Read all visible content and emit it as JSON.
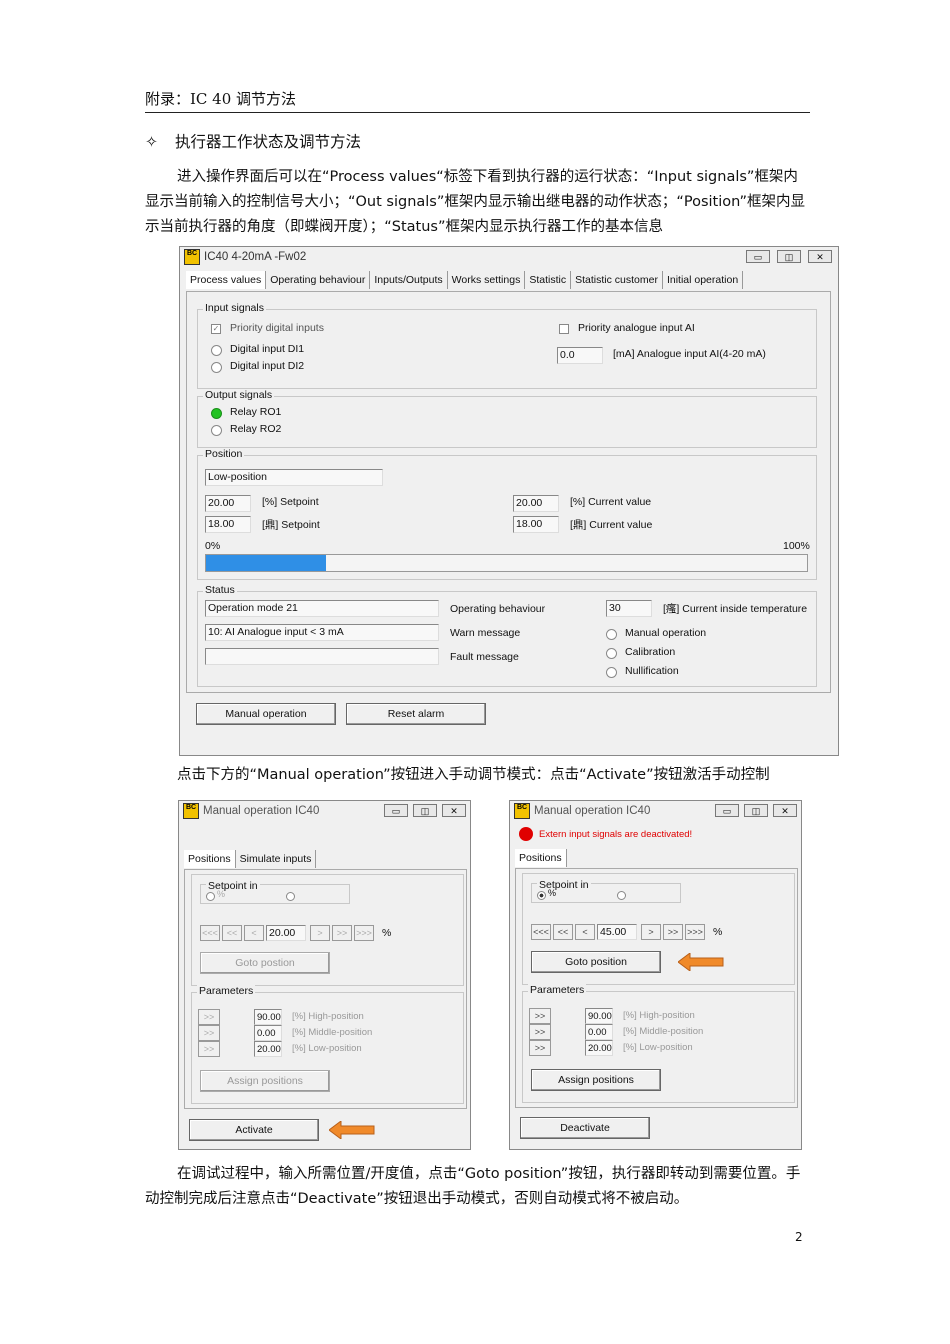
{
  "header": "附录：IC 40 调节方法",
  "section": {
    "bullet": "✧",
    "title": "执行器工作状态及调节方法"
  },
  "para1": "进入操作界面后可以在“Process values“标签下看到执行器的运行状态：“Input signals”框架内显示当前输入的控制信号大小；“Out signals”框架内显示输出继电器的动作状态；“Position”框架内显示当前执行器的角度（即蝶阀开度）；“Status”框架内显示执行器工作的基本信息",
  "para2": "点击下方的“Manual operation”按钮进入手动调节模式：点击“Activate”按钮激活手动控制",
  "para3": "在调试过程中，输入所需位置/开度值，点击“Goto position”按钮，执行器即转动到需要位置。手动控制完成后注意点击“Deactivate”按钮退出手动模式，否则自动模式将不被启动。",
  "page_number": "2",
  "main_window": {
    "logo": "BC",
    "title": "IC40 4-20mA -Fw02",
    "tabs": [
      "Process values",
      "Operating behaviour",
      "Inputs/Outputs",
      "Works settings",
      "Statistic",
      "Statistic customer",
      "Initial operation"
    ],
    "input_signals": {
      "label": "Input signals",
      "priority_digital": "Priority digital inputs",
      "di1": "Digital input DI1",
      "di2": "Digital input DI2",
      "priority_analogue": "Priority analogue input AI",
      "ai_value": "0.0",
      "ai_label": "[mA] Analogue input AI(4-20 mA)"
    },
    "output_signals": {
      "label": "Output signals",
      "ro1": "Relay RO1",
      "ro2": "Relay RO2"
    },
    "position": {
      "label": "Position",
      "state": "Low-position",
      "setpoint_pct": "20.00",
      "setpoint_pct_label": "[%] Setpoint",
      "setpoint_deg": "18.00",
      "setpoint_deg_label": "[鼎] Setpoint",
      "current_pct": "20.00",
      "current_pct_label": "[%] Current value",
      "current_deg": "18.00",
      "current_deg_label": "[鼎] Current value",
      "min_label": "0%",
      "max_label": "100%",
      "progress": 0.2
    },
    "status": {
      "label": "Status",
      "mode": "Operation  mode 21",
      "warn": "10: AI Analogue input < 3 mA",
      "fault": "",
      "operating_behaviour": "Operating behaviour",
      "warn_message": "Warn message",
      "fault_message": "Fault message",
      "temperature": "30",
      "temperature_label": "[瘙] Current inside temperature",
      "manual": "Manual operation",
      "calibration": "Calibration",
      "nullification": "Nullification"
    },
    "btn_manual": "Manual operation",
    "btn_reset": "Reset alarm"
  },
  "manual_left": {
    "logo": "BC",
    "title": "Manual operation IC40",
    "tabs": [
      "Positions",
      "Simulate inputs"
    ],
    "setpoint_in": "Setpoint in",
    "pct": "%",
    "step_buttons": [
      "<<<",
      "<<",
      "<",
      ">",
      ">>",
      ">>>"
    ],
    "value": "20.00",
    "unit": "%",
    "goto": "Goto postion",
    "parameters": "Parameters",
    "param_buttons": [
      ">>",
      ">>",
      ">>"
    ],
    "high": "90.00",
    "high_label": "[%] High-position",
    "middle": "0.00",
    "middle_label": "[%] Middle-position",
    "low": "20.00",
    "low_label": "[%] Low-position",
    "assign": "Assign positions",
    "activate": "Activate"
  },
  "manual_right": {
    "logo": "BC",
    "title": "Manual operation IC40",
    "alert": "Extern input signals are deactivated!",
    "tabs": [
      "Positions"
    ],
    "setpoint_in": "Setpoint in",
    "pct": "%",
    "step_buttons": [
      "<<<",
      "<<",
      "<",
      ">",
      ">>",
      ">>>"
    ],
    "value": "45.00",
    "unit": "%",
    "goto": "Goto position",
    "parameters": "Parameters",
    "param_buttons": [
      ">>",
      ">>",
      ">>"
    ],
    "high": "90.00",
    "high_label": "[%] High-position",
    "middle": "0.00",
    "middle_label": "[%] Middle-position",
    "low": "20.00",
    "low_label": "[%] Low-position",
    "assign": "Assign positions",
    "deactivate": "Deactivate"
  },
  "colors": {
    "relay_on": "#22c322",
    "progress": "#2f8fe6",
    "arrow": "#f08a2a",
    "alert": "#e00000"
  }
}
